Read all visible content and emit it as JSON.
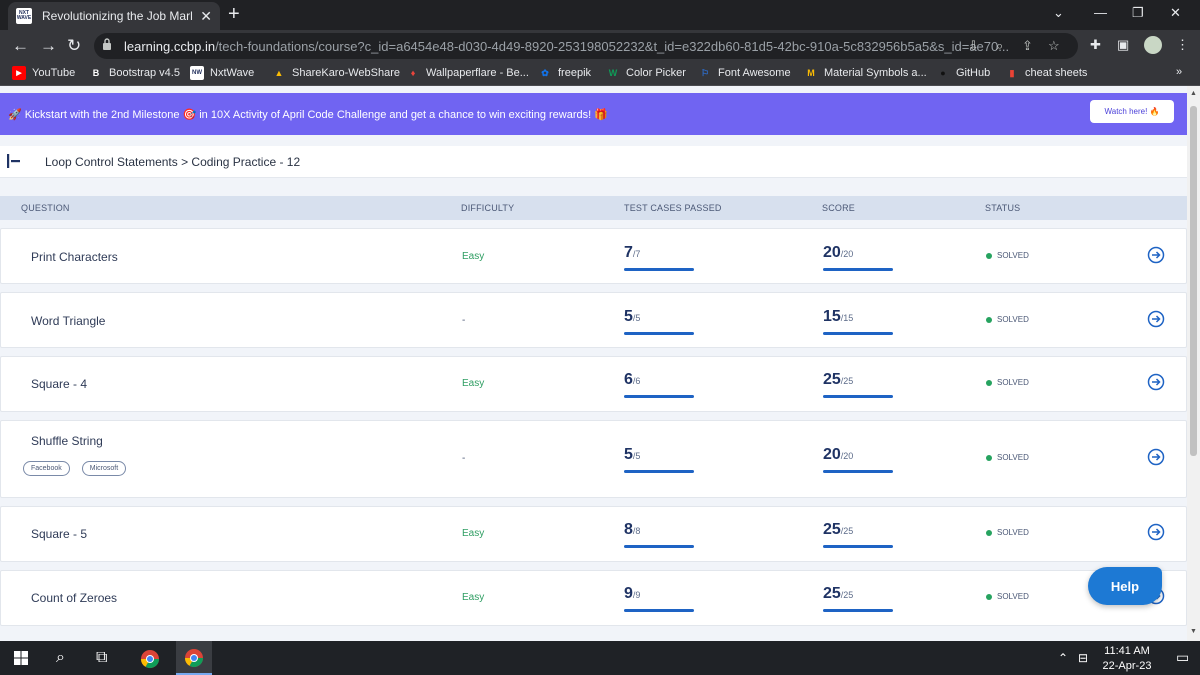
{
  "browser": {
    "tab_title": "Revolutionizing the Job Market |",
    "tab_favicon_text": "NXT WAVE",
    "tab_close": "✕",
    "new_tab": "+",
    "url_host": "learning.ccbp.in",
    "url_path": "/tech-foundations/course?c_id=a6454e48-d030-4d49-8920-253198052232&t_id=e322db60-81d5-42bc-910a-5c832956b5a5&s_id=ae70...",
    "bookmarks": [
      {
        "label": "YouTube",
        "icon_text": "▶",
        "icon_color": "#ff0000"
      },
      {
        "label": "Bootstrap v4.5",
        "icon_text": "B",
        "icon_color": "#35363a"
      },
      {
        "label": "NxtWave",
        "icon_text": "NW",
        "icon_color": "#ffffff"
      },
      {
        "label": "ShareKaro-WebShare",
        "icon_text": "▲",
        "icon_color": "#fbbc04"
      },
      {
        "label": "Wallpaperflare - Be...",
        "icon_text": "♦",
        "icon_color": "#e8453c"
      },
      {
        "label": "freepik",
        "icon_text": "✿",
        "icon_color": "#1273eb"
      },
      {
        "label": "Color Picker",
        "icon_text": "W",
        "icon_color": "#0f9d58"
      },
      {
        "label": "Font Awesome",
        "icon_text": "⚐",
        "icon_color": "#2d72d9"
      },
      {
        "label": "Material Symbols a...",
        "icon_text": "M",
        "icon_color": "#fbbc04"
      },
      {
        "label": "GitHub",
        "icon_text": "●",
        "icon_color": "#000000"
      },
      {
        "label": "cheat sheets",
        "icon_text": "▮",
        "icon_color": "#ea4335"
      }
    ],
    "bookmarks_overflow": "»"
  },
  "banner": {
    "text": "🚀 Kickstart with the 2nd Milestone 🎯 in 10X Activity of April Code Challenge and get a chance to win exciting rewards! 🎁",
    "button": "Watch here! 🔥"
  },
  "breadcrumb": "Loop Control Statements > Coding Practice - 12",
  "table": {
    "headers": {
      "question": "QUESTION",
      "difficulty": "DIFFICULTY",
      "test_cases": "TEST CASES PASSED",
      "score": "SCORE",
      "status": "STATUS"
    },
    "rows": [
      {
        "question": "Print Characters",
        "difficulty": "Easy",
        "tests_passed": "7",
        "tests_total": "/7",
        "score": "20",
        "score_total": "/20",
        "status": "SOLVED"
      },
      {
        "question": "Word Triangle",
        "difficulty": "-",
        "tests_passed": "5",
        "tests_total": "/5",
        "score": "15",
        "score_total": "/15",
        "status": "SOLVED"
      },
      {
        "question": "Square - 4",
        "difficulty": "Easy",
        "tests_passed": "6",
        "tests_total": "/6",
        "score": "25",
        "score_total": "/25",
        "status": "SOLVED"
      },
      {
        "question": "Shuffle String",
        "difficulty": "-",
        "tests_passed": "5",
        "tests_total": "/5",
        "score": "20",
        "score_total": "/20",
        "status": "SOLVED",
        "tags": [
          "Facebook",
          "Microsoft"
        ]
      },
      {
        "question": "Square - 5",
        "difficulty": "Easy",
        "tests_passed": "8",
        "tests_total": "/8",
        "score": "25",
        "score_total": "/25",
        "status": "SOLVED"
      },
      {
        "question": "Count of Zeroes",
        "difficulty": "Easy",
        "tests_passed": "9",
        "tests_total": "/9",
        "score": "25",
        "score_total": "/25",
        "status": "SOLVED"
      }
    ]
  },
  "help_button": "Help",
  "taskbar": {
    "time": "11:41 AM",
    "date": "22-Apr-23"
  }
}
